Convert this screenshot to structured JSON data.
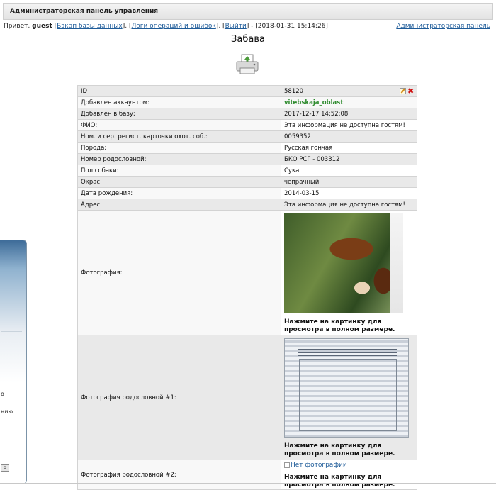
{
  "header": {
    "title": "Администраторская панель управления"
  },
  "userline": {
    "greeting": "Привет, ",
    "username": "guest",
    "links": [
      "Бэкап базы данных",
      "Логи операций и ошибок",
      "Выйти"
    ],
    "datetime": "[2018-01-31 15:14:26]",
    "admin_panel_link": "Администраторская панель"
  },
  "page": {
    "title": "Забава",
    "print_icon": "printer-icon"
  },
  "rows": [
    {
      "label": "ID",
      "value": "58120"
    },
    {
      "label": "Добавлен аккаунтом:",
      "value": "vitebskaja_oblast"
    },
    {
      "label": "Добавлен в базу:",
      "value": "2017-12-17 14:52:08"
    },
    {
      "label": "ФИО:",
      "value": "Эта информация не доступна гостям!"
    },
    {
      "label": "Ном. и сер. регист. карточки охот. соб.:",
      "value": "0059352"
    },
    {
      "label": "Порода:",
      "value": "Русская гончая"
    },
    {
      "label": "Номер родословной:",
      "value": "БКО РСГ - 003312"
    },
    {
      "label": "Пол собаки:",
      "value": "Сука"
    },
    {
      "label": "Окрас:",
      "value": "чепрачный"
    },
    {
      "label": "Дата рождения:",
      "value": "2014-03-15"
    },
    {
      "label": "Адрес:",
      "value": "Эта информация не доступна гостям!"
    }
  ],
  "photos": {
    "photo_label": "Фотография:",
    "pedigree1_label": "Фотография родословной #1:",
    "pedigree2_label": "Фотография родословной #2:",
    "caption": "Нажмите на картинку для просмотра в полном размере.",
    "no_photo": "Нет фотографии"
  },
  "side": {
    "text1": "о",
    "text2": "нию",
    "button": "о"
  },
  "colors": {
    "account": "#2e8b2e",
    "link": "#1f5c99",
    "delete": "#d01010"
  }
}
